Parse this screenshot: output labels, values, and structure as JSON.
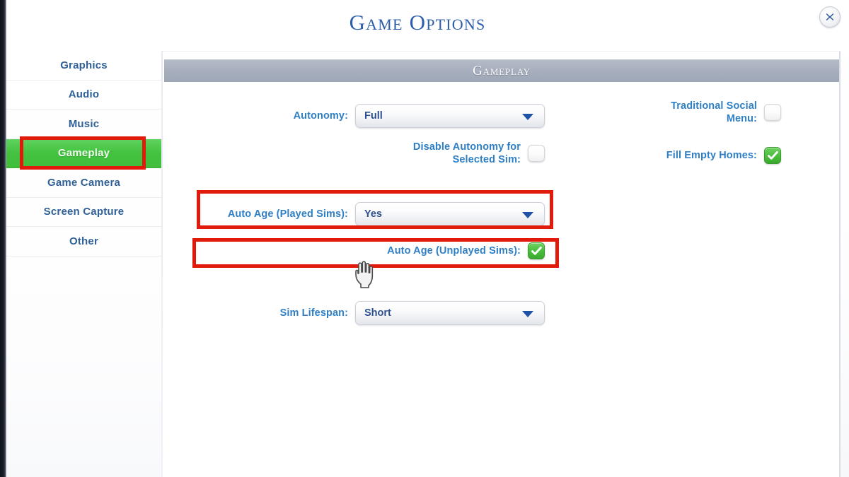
{
  "window": {
    "title": "Game Options",
    "close_icon": "close-icon"
  },
  "sidebar": {
    "items": [
      {
        "label": "Graphics",
        "selected": false
      },
      {
        "label": "Audio",
        "selected": false
      },
      {
        "label": "Music",
        "selected": false
      },
      {
        "label": "Gameplay",
        "selected": true
      },
      {
        "label": "Game Camera",
        "selected": false
      },
      {
        "label": "Screen Capture",
        "selected": false
      },
      {
        "label": "Other",
        "selected": false
      }
    ]
  },
  "panel": {
    "header": "Gameplay",
    "left_column": [
      {
        "label": "Autonomy:",
        "control": "dropdown",
        "value": "Full",
        "highlighted": false
      },
      {
        "label": "Disable Autonomy for\nSelected Sim:",
        "control": "checkbox",
        "checked": false,
        "highlighted": false
      },
      {
        "label": "Auto Age (Played Sims):",
        "control": "dropdown",
        "value": "Yes",
        "highlighted": true
      },
      {
        "label": "Auto Age (Unplayed Sims):",
        "control": "checkbox",
        "checked": true,
        "highlighted": true
      },
      {
        "label": "Sim Lifespan:",
        "control": "dropdown",
        "value": "Short",
        "highlighted": false
      }
    ],
    "right_column": [
      {
        "label": "Traditional Social\nMenu:",
        "control": "checkbox",
        "checked": false
      },
      {
        "label": "Fill Empty Homes:",
        "control": "checkbox",
        "checked": true
      }
    ]
  },
  "colors": {
    "accent_blue": "#2f7fc4",
    "title_blue": "#2b5eab",
    "selected_green": "#43c23f",
    "checkbox_green": "#4cc03f",
    "annotation_red": "#e01b0c",
    "header_gray": "#a6aebd"
  },
  "cursor": {
    "type": "pointing-hand-cursor"
  }
}
